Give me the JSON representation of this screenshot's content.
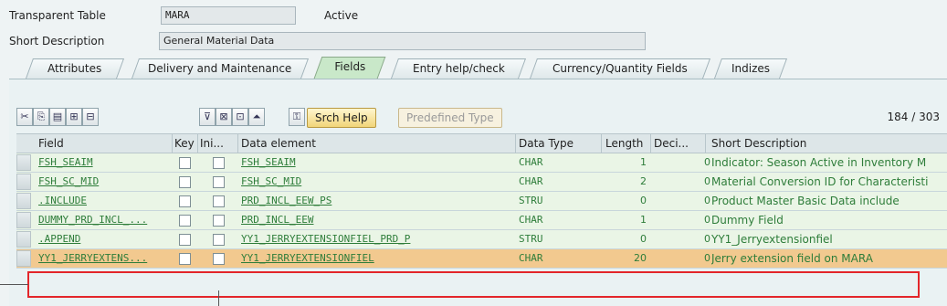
{
  "header": {
    "table_type_label": "Transparent Table",
    "table_name": "MARA",
    "status": "Active",
    "short_desc_label": "Short Description",
    "short_desc_value": "General Material Data"
  },
  "tabs": [
    {
      "label": "Attributes"
    },
    {
      "label": "Delivery and Maintenance"
    },
    {
      "label": "Fields"
    },
    {
      "label": "Entry help/check"
    },
    {
      "label": "Currency/Quantity Fields"
    },
    {
      "label": "Indizes"
    }
  ],
  "toolbar": {
    "srch_help": "Srch Help",
    "predefined_type": "Predefined Type",
    "counter": "184  /  303"
  },
  "columns": [
    "Field",
    "Key",
    "Ini...",
    "Data element",
    "Data Type",
    "Length",
    "Deci...",
    "Short Description"
  ],
  "rows": [
    {
      "field": "FSH_SEAIM",
      "element": "FSH_SEAIM",
      "type": "CHAR",
      "length": "1",
      "deci": "0",
      "desc": "Indicator: Season Active in Inventory M"
    },
    {
      "field": "FSH_SC_MID",
      "element": "FSH_SC_MID",
      "type": "CHAR",
      "length": "2",
      "deci": "0",
      "desc": "Material Conversion ID for Characteristi"
    },
    {
      "field": ".INCLUDE",
      "element": "PRD_INCL_EEW_PS",
      "type": "STRU",
      "length": "0",
      "deci": "0",
      "desc": "Product Master Basic Data include"
    },
    {
      "field": "DUMMY_PRD_INCL_...",
      "element": "PRD_INCL_EEW",
      "type": "CHAR",
      "length": "1",
      "deci": "0",
      "desc": "Dummy Field"
    },
    {
      "field": ".APPEND",
      "element": "YY1_JERRYEXTENSIONFIEL_PRD_P",
      "type": "STRU",
      "length": "0",
      "deci": "0",
      "desc": "YY1_Jerryextensionfiel"
    },
    {
      "field": "YY1_JERRYEXTENS...",
      "element": "YY1_JERRYEXTENSIONFIEL",
      "type": "CHAR",
      "length": "20",
      "deci": "0",
      "desc": "Jerry extension field on MARA"
    }
  ]
}
